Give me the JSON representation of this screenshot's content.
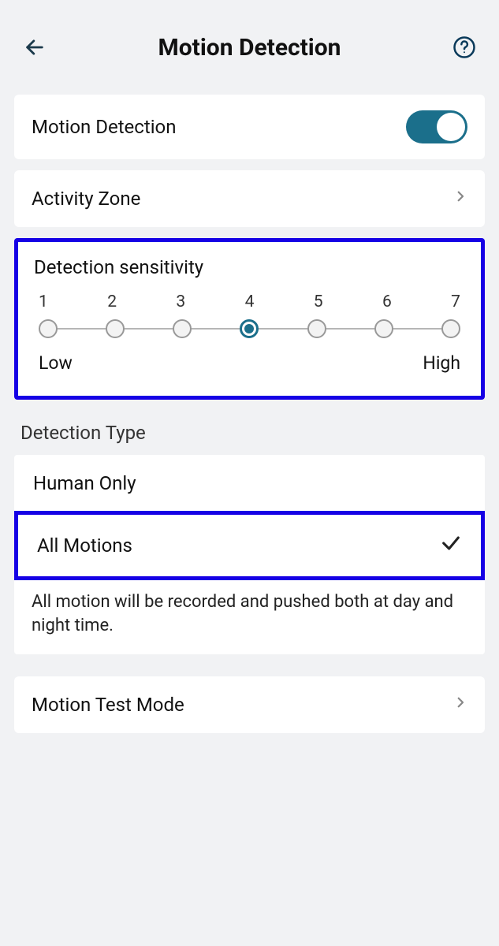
{
  "header": {
    "title": "Motion Detection"
  },
  "rows": {
    "motion_detection": "Motion Detection",
    "activity_zone": "Activity Zone",
    "motion_test_mode": "Motion Test Mode"
  },
  "toggles": {
    "motion_detection_on": true
  },
  "sensitivity": {
    "title": "Detection sensitivity",
    "ticks": [
      "1",
      "2",
      "3",
      "4",
      "5",
      "6",
      "7"
    ],
    "selected_index": 3,
    "low_label": "Low",
    "high_label": "High"
  },
  "detection_type": {
    "section_label": "Detection Type",
    "options": [
      {
        "label": "Human Only",
        "selected": false
      },
      {
        "label": "All Motions",
        "selected": true
      }
    ],
    "description": "All motion will be recorded and pushed both at day and night time."
  },
  "colors": {
    "highlight": "#1600e5",
    "accent": "#1b6f8b",
    "bg": "#f1f2f4"
  },
  "icons": {
    "back": "back-arrow",
    "help": "help-circle",
    "chevron": "chevron-right",
    "check": "checkmark"
  }
}
